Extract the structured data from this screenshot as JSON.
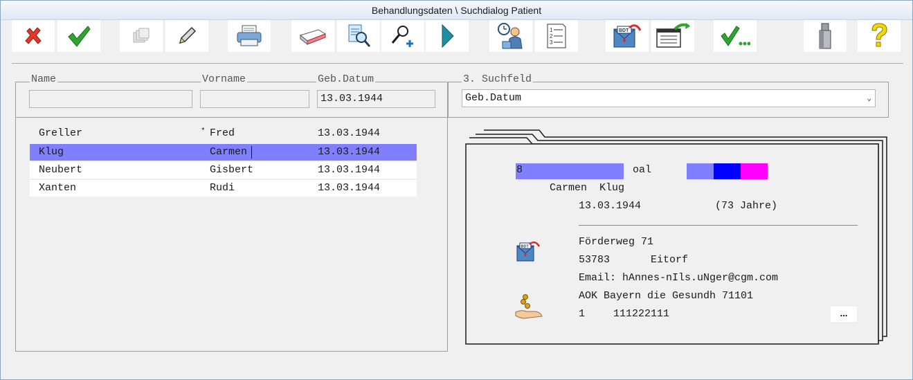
{
  "window": {
    "title": "Behandlungsdaten \\ Suchdialog Patient"
  },
  "toolbar": {
    "buttons": [
      {
        "name": "cancel",
        "icon": "red-x-icon"
      },
      {
        "name": "ok",
        "icon": "green-check-icon"
      },
      {
        "name": "stack",
        "icon": "stack-cards-icon"
      },
      {
        "name": "edit",
        "icon": "pencil-icon"
      },
      {
        "name": "print",
        "icon": "printer-icon"
      },
      {
        "name": "erase",
        "icon": "eraser-icon"
      },
      {
        "name": "search-doc",
        "icon": "document-search-icon"
      },
      {
        "name": "zoom-add",
        "icon": "magnifier-plus-icon"
      },
      {
        "name": "next",
        "icon": "play-arrow-icon"
      },
      {
        "name": "appointment",
        "icon": "clock-person-icon"
      },
      {
        "name": "list",
        "icon": "numbered-list-icon"
      },
      {
        "name": "bdt-mail",
        "icon": "bdt-envelope-icon"
      },
      {
        "name": "export",
        "icon": "form-arrow-icon"
      },
      {
        "name": "check-more",
        "icon": "check-ellipsis-icon",
        "label": "✓..."
      },
      {
        "name": "usb",
        "icon": "usb-stick-icon"
      },
      {
        "name": "help",
        "icon": "question-mark-icon"
      }
    ]
  },
  "search": {
    "name_label": "Name",
    "vorname_label": "Vorname",
    "gebdatum_label": "Geb.Datum",
    "name_value": "",
    "vorname_value": "",
    "gebdatum_value": "13.03.1944",
    "suchfeld_label": "3. Suchfeld",
    "suchfeld_value": "Geb.Datum"
  },
  "results": [
    {
      "name": "Greller",
      "marker": "*",
      "vorname": "Fred",
      "gebdatum": "13.03.1944"
    },
    {
      "name": "Klug",
      "marker": "",
      "vorname": "Carmen",
      "gebdatum": "13.03.1944"
    },
    {
      "name": "Neubert",
      "marker": "",
      "vorname": "Gisbert",
      "gebdatum": "13.03.1944"
    },
    {
      "name": "Xanten",
      "marker": "",
      "vorname": "Rudi",
      "gebdatum": "13.03.1944"
    }
  ],
  "selected_row": 1,
  "patient_card": {
    "number": "8",
    "code": "oal",
    "color_swatches": [
      "#8080ff",
      "#0000ff",
      "#ff00ff"
    ],
    "full_name": "Carmen  Klug",
    "birthdate": "13.03.1944",
    "age": "(73 Jahre)",
    "street": "Förderweg 71",
    "zip": "53783",
    "city": "Eitorf",
    "email": "Email: hAnnes-nIls.uNger@cgm.com",
    "insurance": "AOK Bayern die Gesundh 71101",
    "insurance_status": "1",
    "insurance_number": "111222111",
    "more_button": "..."
  }
}
